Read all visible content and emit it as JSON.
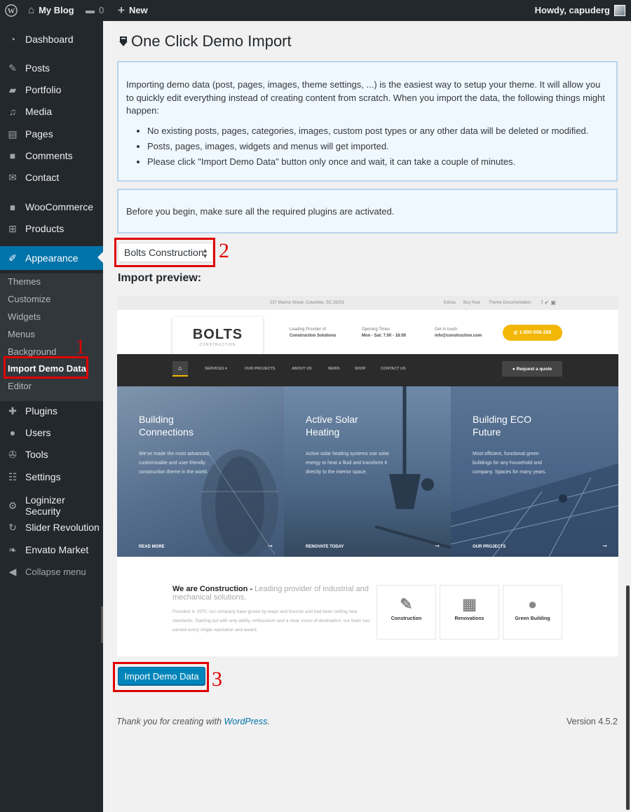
{
  "adminbar": {
    "wp_icon": "wordpress-logo-icon",
    "site_name": "My Blog",
    "comments_count": "0",
    "new_label": "New",
    "howdy": "Howdy, capuderg"
  },
  "sidebar": {
    "items": [
      {
        "label": "Dashboard",
        "icon": "dashboard-icon"
      },
      {
        "label": "Posts",
        "icon": "pin-icon"
      },
      {
        "label": "Portfolio",
        "icon": "folder-icon"
      },
      {
        "label": "Media",
        "icon": "media-icon"
      },
      {
        "label": "Pages",
        "icon": "pages-icon"
      },
      {
        "label": "Comments",
        "icon": "comment-icon"
      },
      {
        "label": "Contact",
        "icon": "mail-icon"
      },
      {
        "label": "WooCommerce",
        "icon": "woo-icon"
      },
      {
        "label": "Products",
        "icon": "cart-icon"
      },
      {
        "label": "Appearance",
        "icon": "brush-icon"
      },
      {
        "label": "Plugins",
        "icon": "plugin-icon"
      },
      {
        "label": "Users",
        "icon": "user-icon"
      },
      {
        "label": "Tools",
        "icon": "wrench-icon"
      },
      {
        "label": "Settings",
        "icon": "settings-icon"
      },
      {
        "label": "Loginizer Security",
        "icon": "gear-icon"
      },
      {
        "label": "Slider Revolution",
        "icon": "refresh-icon"
      },
      {
        "label": "Envato Market",
        "icon": "leaf-icon"
      },
      {
        "label": "Collapse menu",
        "icon": "collapse-icon"
      }
    ],
    "submenu": [
      "Themes",
      "Customize",
      "Widgets",
      "Menus",
      "Background",
      "Import Demo Data",
      "Editor"
    ]
  },
  "annotations": {
    "one": "1",
    "two": "2",
    "three": "3"
  },
  "main": {
    "title": "One Click Demo Import",
    "intro": "Importing demo data (post, pages, images, theme settings, ...) is the easiest way to setup your theme. It will allow you to quickly edit everything instead of creating content from scratch. When you import the data, the following things might happen:",
    "bullets": [
      "No existing posts, pages, categories, images, custom post types or any other data will be deleted or modified.",
      "Posts, pages, images, widgets and menus will get imported.",
      "Please click \"Import Demo Data\" button only once and wait, it can take a couple of minutes."
    ],
    "notice2": "Before you begin, make sure all the required plugins are activated.",
    "select_value": "Bolts Construction",
    "preview_label": "Import preview:",
    "import_button": "Import Demo Data"
  },
  "preview": {
    "address": "237 Marino Street, Columbia, SC 29201",
    "links": [
      "Extras",
      "Buy Now",
      "Theme Documentation"
    ],
    "logo": "BOLTS",
    "logo_sub": "CONSTRUCTION",
    "info1_a": "Leading Provider of",
    "info1_b": "Construction Solutions",
    "info2_a": "Opening Times",
    "info2_b": "Mon - Sat: 7.00 - 18:00",
    "info3_a": "Get in touch",
    "info3_b": "info@construction.com",
    "phone": "1-800-506-266",
    "nav": [
      "SERVICES ▾",
      "OUR PROJECTS",
      "ABOUT US",
      "NEWS",
      "SHOP",
      "CONTACT US"
    ],
    "quote": "Request a quote",
    "panels": [
      {
        "title1": "Building",
        "title2": "Connections",
        "desc": "We've made the most advanced, customizable and user-friendly construction theme in the world.",
        "footer": "READ MORE"
      },
      {
        "title1": "Active Solar",
        "title2": "Heating",
        "desc": "Active solar heating systems use solar energy to heat a fluid and transform it directly to the interior space.",
        "footer": "RENOVATE TODAY"
      },
      {
        "title1": "Building ECO",
        "title2": "Future",
        "desc": "Most efficient, functional green buildings for any household and company. Spaces for many years.",
        "footer": "OUR PROJECTS"
      }
    ],
    "about_bold": "We are Construction -",
    "about_rest": " Leading provider of industrial and mechanical solutions.",
    "about_text": "Founded in 1970, our company have grown by leaps and bounds and had been setting new standards. Starting put with only ability, enthusiasm and a clear vision of destination, our team has earned every single reputation and award.",
    "cards": [
      "Construction",
      "Renovations",
      "Green Building"
    ]
  },
  "footer": {
    "thanks": "Thank you for creating with ",
    "wp_link": "WordPress",
    "period": ".",
    "version": "Version 4.5.2"
  },
  "colors": {
    "sidebar": "#23282d",
    "accent": "#0073aa",
    "annotation": "#e00000",
    "button": "#0085ba"
  }
}
